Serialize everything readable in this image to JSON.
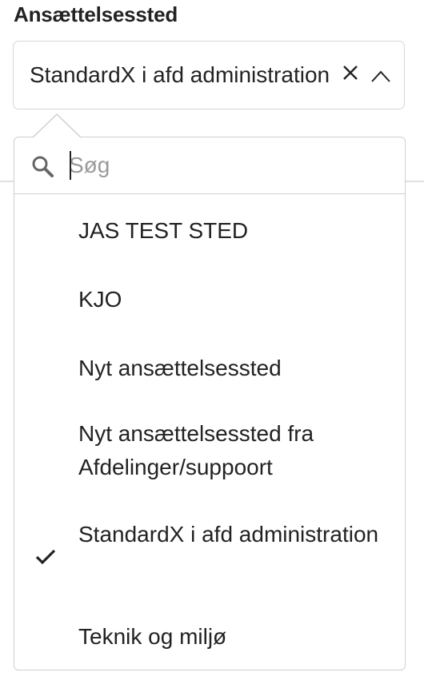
{
  "field": {
    "label": "Ansættelsessted",
    "selected_value": "StandardX i afd administration"
  },
  "icons": {
    "clear": "close-icon",
    "toggle": "chevron-up-icon",
    "search": "search-icon",
    "selected": "check-icon"
  },
  "search": {
    "placeholder": "Søg",
    "value": ""
  },
  "options": [
    {
      "label": "JAS TEST STED",
      "selected": false
    },
    {
      "label": "KJO",
      "selected": false
    },
    {
      "label": "Nyt ansættelsessted",
      "selected": false
    },
    {
      "label": "Nyt ansættelsessted fra Afdelinger/suppoort",
      "selected": false
    },
    {
      "label": "StandardX i afd administration",
      "selected": true
    },
    {
      "label": "Teknik og miljø",
      "selected": false
    }
  ],
  "colors": {
    "text": "#222222",
    "border": "#cfcfcf",
    "placeholder": "#9a9a9a"
  }
}
